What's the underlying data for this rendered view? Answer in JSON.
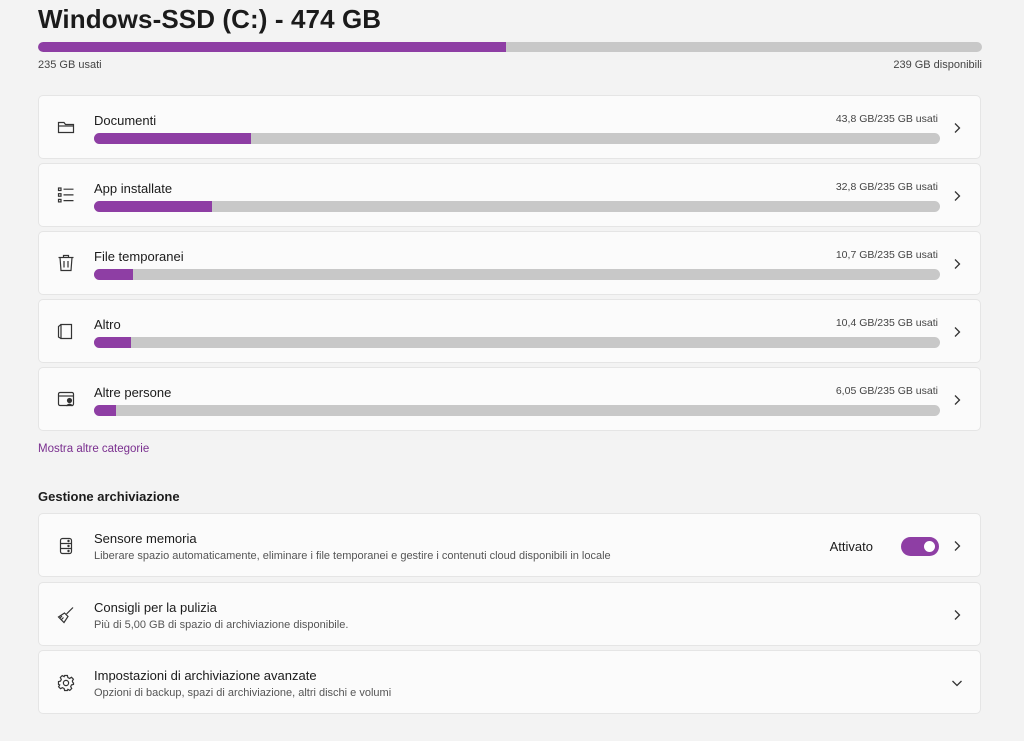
{
  "drive": {
    "title": "Windows-SSD (C:) - 474 GB",
    "used_label": "235 GB usati",
    "free_label": "239 GB disponibili",
    "used_fraction": 0.496
  },
  "categories": [
    {
      "name": "Documenti",
      "size": "43,8 GB/235 GB usati",
      "fraction": 0.186,
      "icon": "folder-icon"
    },
    {
      "name": "App installate",
      "size": "32,8 GB/235 GB usati",
      "fraction": 0.14,
      "icon": "list-icon"
    },
    {
      "name": "File temporanei",
      "size": "10,7 GB/235 GB usati",
      "fraction": 0.046,
      "icon": "trash-icon"
    },
    {
      "name": "Altro",
      "size": "10,4 GB/235 GB usati",
      "fraction": 0.044,
      "icon": "document-icon"
    },
    {
      "name": "Altre persone",
      "size": "6,05 GB/235 GB usati",
      "fraction": 0.026,
      "icon": "user-folder-icon"
    }
  ],
  "more_link": "Mostra altre categorie",
  "section_title": "Gestione archiviazione",
  "settings": [
    {
      "title": "Sensore memoria",
      "desc": "Liberare spazio automaticamente, eliminare i file temporanei e gestire i contenuti cloud disponibili in locale",
      "toggle_label": "Attivato",
      "icon": "storage-sense-icon"
    },
    {
      "title": "Consigli per la pulizia",
      "desc": "Più di 5,00 GB di spazio di archiviazione disponibile.",
      "icon": "broom-icon"
    },
    {
      "title": "Impostazioni di archiviazione avanzate",
      "desc": "Opzioni di backup, spazi di archiviazione, altri dischi e volumi",
      "icon": "gear-icon"
    }
  ],
  "colors": {
    "accent": "#8e3ea4",
    "track": "#c8c8c8"
  }
}
